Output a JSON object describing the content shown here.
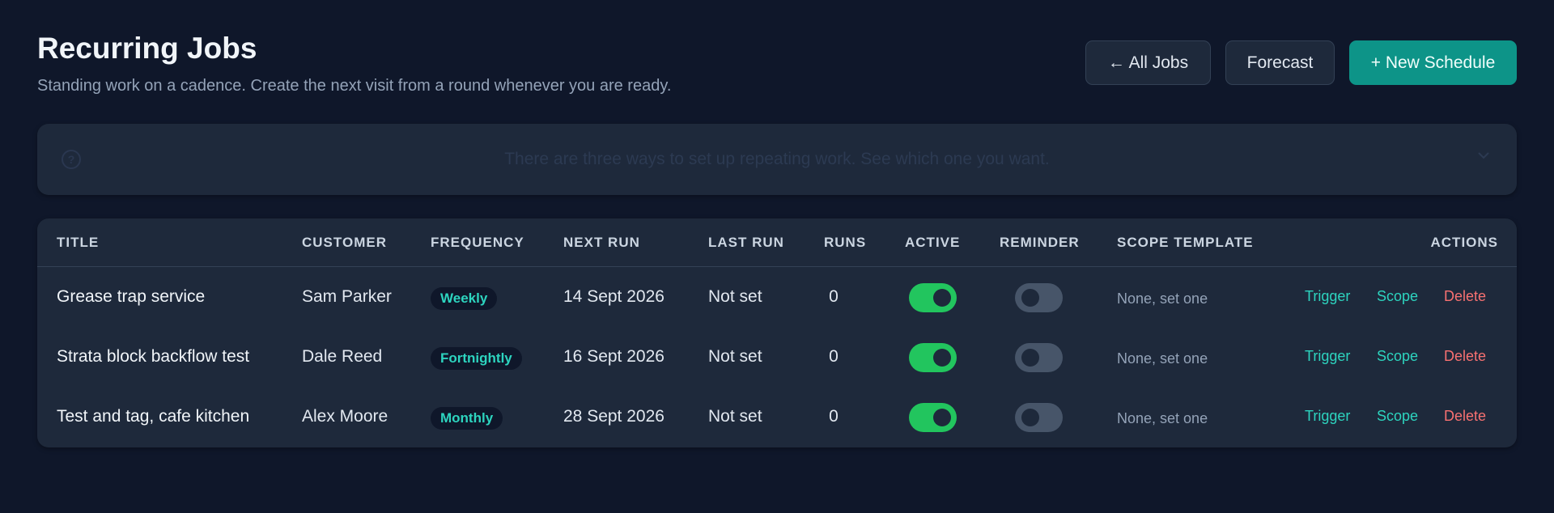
{
  "header": {
    "title": "Recurring Jobs",
    "subtitle": "Standing work on a cadence. Create the next visit from a round whenever you are ready.",
    "buttons": {
      "all_jobs": "← All Jobs",
      "forecast": "Forecast",
      "new_schedule": "+ New Schedule"
    }
  },
  "banner": {
    "icon": "help-circle-icon",
    "text": "There are three ways to set up repeating work. See which one you want.",
    "chevron": "chevron-down-icon"
  },
  "table": {
    "columns": {
      "title": "Title",
      "customer": "Customer",
      "frequency": "Frequency",
      "next_run": "Next Run",
      "last_run": "Last Run",
      "runs": "Runs",
      "active": "Active",
      "reminder": "Reminder",
      "scope_template": "Scope Template",
      "actions": "Actions"
    },
    "rows": [
      {
        "title": "Grease trap service",
        "customer": "Sam Parker",
        "frequency": "Weekly",
        "next_run": "14 Sept 2026",
        "last_run": "Not set",
        "runs": "0",
        "active": true,
        "reminder": false,
        "scope_template": "None, set one",
        "actions": {
          "trigger": "Trigger",
          "scope": "Scope",
          "delete": "Delete"
        }
      },
      {
        "title": "Strata block backflow test",
        "customer": "Dale Reed",
        "frequency": "Fortnightly",
        "next_run": "16 Sept 2026",
        "last_run": "Not set",
        "runs": "0",
        "active": true,
        "reminder": false,
        "scope_template": "None, set one",
        "actions": {
          "trigger": "Trigger",
          "scope": "Scope",
          "delete": "Delete"
        }
      },
      {
        "title": "Test and tag, cafe kitchen",
        "customer": "Alex Moore",
        "frequency": "Monthly",
        "next_run": "28 Sept 2026",
        "last_run": "Not set",
        "runs": "0",
        "active": true,
        "reminder": false,
        "scope_template": "None, set one",
        "actions": {
          "trigger": "Trigger",
          "scope": "Scope",
          "delete": "Delete"
        }
      }
    ]
  },
  "colors": {
    "background": "#0f172a",
    "card": "#1e293b",
    "accent": "#0d9488",
    "link": "#2dd4bf",
    "danger": "#f87171",
    "toggle_on": "#22c55e",
    "toggle_off": "#475569"
  }
}
